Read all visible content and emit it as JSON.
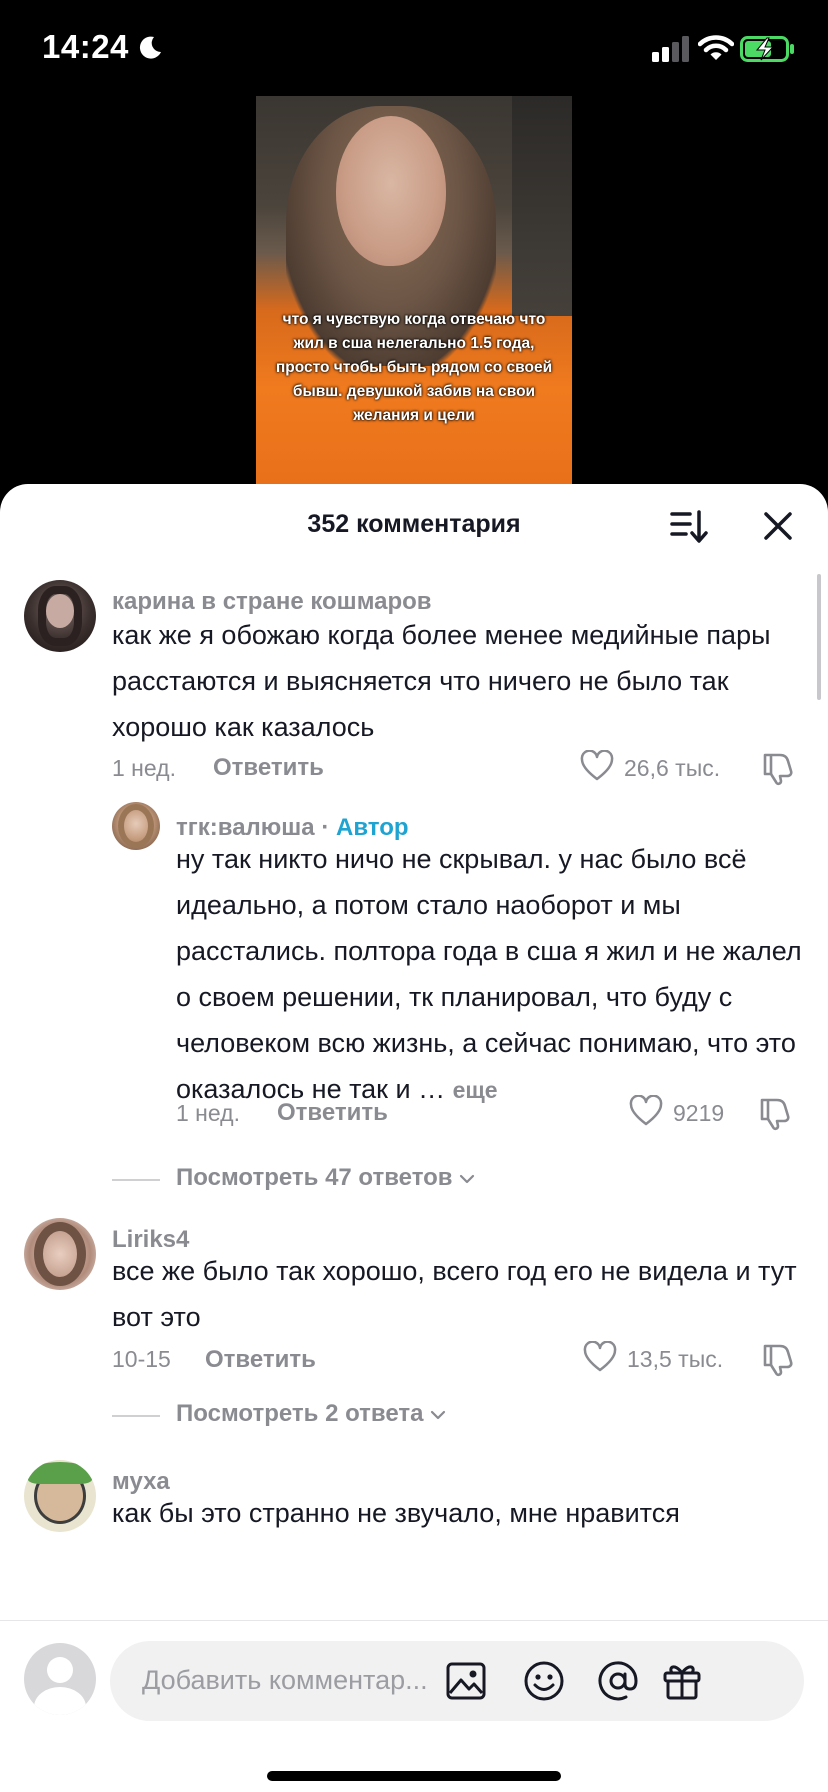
{
  "status_bar": {
    "time": "14:24"
  },
  "video": {
    "caption": "что я чувствую когда отвечаю что жил в сша нелегально 1.5 года, просто чтобы быть рядом со своей бывш. девушкой забив на свои желания и цели"
  },
  "sheet": {
    "title": "352 комментария"
  },
  "comments": [
    {
      "username": "карина в стране кошмаров",
      "text": "как же я обожаю когда более менее медийные пары расстаются и выясняется что ничего не было так хорошо как казалось",
      "time": "1 нед.",
      "reply_label": "Ответить",
      "likes": "26,6 тыс."
    },
    {
      "username": "тгк:валюша",
      "author_separator": "·",
      "author_label": "Автор",
      "text": "ну так никто ничо не скрывал. у нас было всё идеально, а потом стало наоборот и мы расстались. полтора года в сша я жил и не жалел о своем решении, тк планировал, что буду с человеком всю жизнь, а сейчас понимаю, что это оказалось не так и …",
      "more_label": "еще",
      "time": "1 нед.",
      "reply_label": "Ответить",
      "likes": "9219"
    },
    {
      "username": "Liriks4",
      "text": "все же было так хорошо, всего год его не видела и тут вот это",
      "time": "10-15",
      "reply_label": "Ответить",
      "likes": "13,5 тыс."
    },
    {
      "username": "муха",
      "text": "как бы это странно не звучало, мне нравится"
    }
  ],
  "view_replies": [
    {
      "label": "Посмотреть 47 ответов"
    },
    {
      "label": "Посмотреть 2 ответа"
    }
  ],
  "input": {
    "placeholder": "Добавить комментар..."
  },
  "icons": {
    "sort": "sort-icon",
    "close": "close-icon",
    "like": "heart-icon",
    "dislike": "thumbs-down-icon",
    "image": "image-icon",
    "emoji": "emoji-icon",
    "mention": "at-icon",
    "gift": "gift-icon"
  },
  "colors": {
    "author_tag": "#1fa3d1",
    "secondary_text": "#8a8b91",
    "primary_text": "#161823",
    "battery": "#4cd964"
  }
}
